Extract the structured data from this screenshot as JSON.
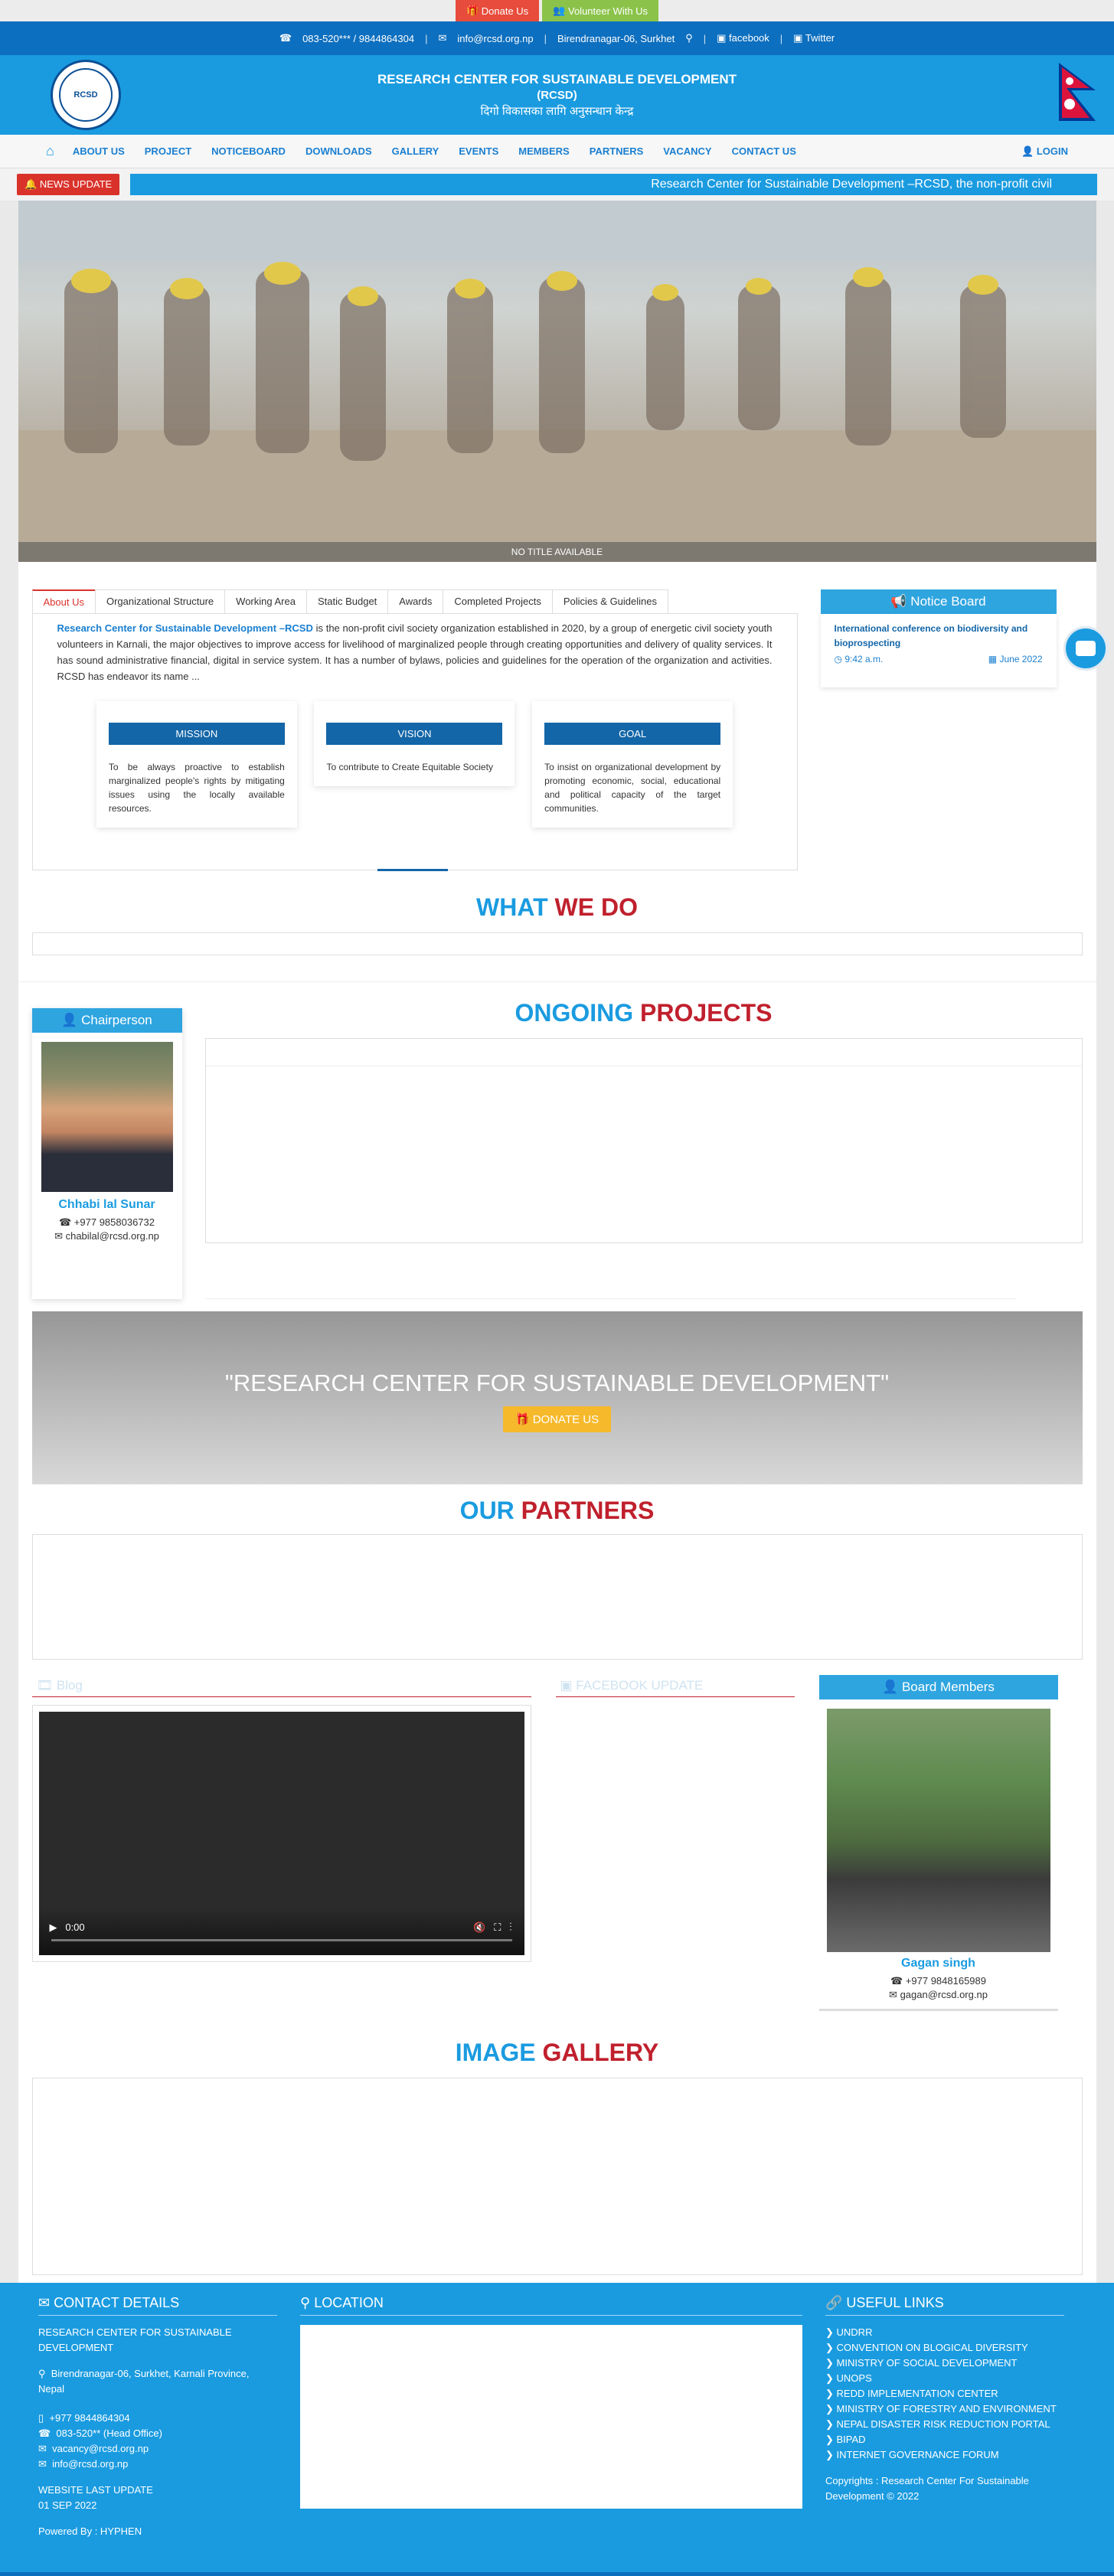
{
  "top_buttons": {
    "donate": "Donate Us",
    "volunteer": "Volunteer With Us"
  },
  "contact_bar": {
    "phone": "083-520*** / 9844864304",
    "email": "info@rcsd.org.np",
    "address": "Birendranagar-06, Surkhet",
    "facebook": "facebook",
    "twitter": "Twitter"
  },
  "header": {
    "title": "RESEARCH CENTER FOR SUSTAINABLE DEVELOPMENT",
    "abbr": "(RCSD)",
    "nepali": "दिगो विकासका लागि अनुसन्धान केन्द्र",
    "logo_text": "RCSD"
  },
  "nav": {
    "items": [
      "ABOUT US",
      "PROJECT",
      "NOTICEBOARD",
      "DOWNLOADS",
      "GALLERY",
      "EVENTS",
      "MEMBERS",
      "PARTNERS",
      "VACANCY",
      "CONTACT US"
    ],
    "login": "LOGIN"
  },
  "news": {
    "label": "NEWS UPDATE",
    "ticker": "Research Center for Sustainable Development –RCSD, the non-profit civil"
  },
  "hero": {
    "caption": "NO TITLE AVAILABLE"
  },
  "tabs": [
    "About Us",
    "Organizational Structure",
    "Working Area",
    "Static Budget",
    "Awards",
    "Completed Projects",
    "Policies & Guidelines"
  ],
  "about": {
    "highlight": "Research Center for Sustainable Development –RCSD",
    "text": " is the non-profit civil society organization established in 2020, by a group of energetic civil society youth volunteers in Karnali, the major objectives to improve access for livelihood of marginalized people through creating opportunities and delivery of quality services. It has sound administrative financial, digital in service system. It has a number of bylaws, policies and guidelines for the operation of the organization and activities. RCSD has endeavor its name ..."
  },
  "cards": [
    {
      "title": "MISSION",
      "text": "To be always proactive to establish marginalized people's rights by mitigating issues using the locally available resources."
    },
    {
      "title": "VISION",
      "text": "To contribute to Create Equitable Society"
    },
    {
      "title": "GOAL",
      "text": "To insist on organizational development by promoting economic, social, educational and political capacity of the target communities."
    }
  ],
  "notice": {
    "heading": "Notice Board",
    "title": "International conference on biodiversity and bioprospecting",
    "time": "9:42 a.m.",
    "date": "June 2022"
  },
  "sections": {
    "what_a": "WHAT",
    "what_b": "WE DO",
    "ongoing_a": "ONGOING",
    "ongoing_b": "PROJECTS",
    "partners_a": "OUR",
    "partners_b": "PARTNERS",
    "gallery_a": "IMAGE",
    "gallery_b": "GALLERY"
  },
  "chair": {
    "heading": "Chairperson",
    "name": "Chhabi lal Sunar",
    "phone": "+977 9858036732",
    "email": "chabilal@rcsd.org.np"
  },
  "banner": {
    "quote": "\"RESEARCH CENTER FOR SUSTAINABLE DEVELOPMENT\"",
    "donate": "DONATE US"
  },
  "blog": {
    "heading": "Blog",
    "video_time": "0:00"
  },
  "facebook": {
    "heading": "FACEBOOK UPDATE"
  },
  "board": {
    "heading": "Board Members",
    "name": "Gagan singh",
    "phone": "+977 9848165989",
    "email": "gagan@rcsd.org.np"
  },
  "footer": {
    "contact_heading": "CONTACT DETAILS",
    "org": "RESEARCH CENTER FOR SUSTAINABLE DEVELOPMENT",
    "address": "Birendranagar-06, Surkhet, Karnali Province, Nepal",
    "mobile": "+977 9844864304",
    "office": "083-520** (Head Office)",
    "email1": "vacancy@rcsd.org.np",
    "email2": "info@rcsd.org.np",
    "last_update_label": "WEBSITE LAST UPDATE",
    "last_update": "01 SEP 2022",
    "powered": "Powered By : HYPHEN",
    "location_heading": "LOCATION",
    "links_heading": "USEFUL LINKS",
    "links": [
      "UNDRR",
      "CONVENTION ON BLOGICAL DIVERSITY",
      "MINISTRY OF SOCIAL DEVELOPMENT",
      "UNOPS",
      "REDD IMPLEMENTATION CENTER",
      "MINISTRY OF FORESTRY AND ENVIRONMENT",
      "NEPAL DISASTER RISK REDUCTION PORTAL",
      "BIPAD",
      "INTERNET GOVERNANCE FORUM"
    ],
    "copyright": "Copyrights : Research Center For Sustainable Development © 2022"
  },
  "colors": {
    "primary": "#1a9be0",
    "dark_blue": "#0d6fbf",
    "red": "#c0202d",
    "donate_yellow": "#f6b92b"
  }
}
